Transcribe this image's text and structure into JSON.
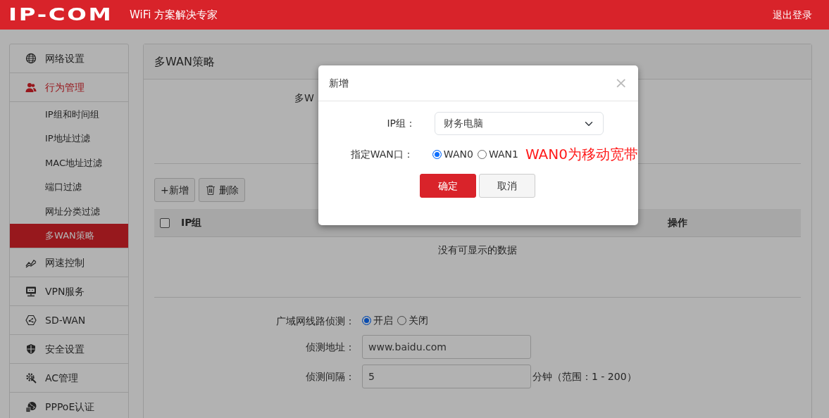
{
  "header": {
    "logo": "IP-COM",
    "tagline": "WiFi 方案解决专家",
    "logout": "退出登录"
  },
  "sidebar": {
    "items": [
      {
        "label": "网络设置",
        "expanded": false
      },
      {
        "label": "行为管理",
        "expanded": true,
        "children": [
          {
            "label": "IP组和时间组",
            "selected": false
          },
          {
            "label": "IP地址过滤",
            "selected": false
          },
          {
            "label": "MAC地址过滤",
            "selected": false
          },
          {
            "label": "端口过滤",
            "selected": false
          },
          {
            "label": "网址分类过滤",
            "selected": false
          },
          {
            "label": "多WAN策略",
            "selected": true
          }
        ]
      },
      {
        "label": "网速控制",
        "expanded": false
      },
      {
        "label": "VPN服务",
        "expanded": false
      },
      {
        "label": "SD-WAN",
        "expanded": false
      },
      {
        "label": "安全设置",
        "expanded": false
      },
      {
        "label": "AC管理",
        "expanded": false
      },
      {
        "label": "PPPoE认证",
        "expanded": false
      }
    ]
  },
  "panel": {
    "title": "多WAN策略",
    "hidden_label": "多W",
    "toolbar": [
      {
        "label": "+新增",
        "kind": "add"
      },
      {
        "label": "删除",
        "kind": "delete"
      }
    ],
    "table": {
      "select_all": false,
      "columns": [
        "IP组",
        "操作"
      ],
      "empty_text": "没有可显示的数据"
    },
    "detection": {
      "label": "广域网线路侦测：",
      "options": [
        {
          "label": "开启",
          "selected": true
        },
        {
          "label": "关闭",
          "selected": false
        }
      ]
    },
    "address": {
      "label": "侦测地址：",
      "value": "www.baidu.com"
    },
    "interval": {
      "label": "侦测间隔：",
      "value": "5",
      "unit": "分钟（范围：1 - 200）"
    }
  },
  "modal": {
    "title": "新增",
    "close": "×",
    "ip_group": {
      "label": "IP组：",
      "value": "财务电脑"
    },
    "wan": {
      "label": "指定WAN口：",
      "options": [
        {
          "label": "WAN0",
          "selected": true
        },
        {
          "label": "WAN1",
          "selected": false
        }
      ]
    },
    "annotation": "WAN0为移动宽带",
    "buttons": [
      {
        "label": "确定",
        "kind": "primary"
      },
      {
        "label": "取消",
        "kind": "secondary"
      }
    ]
  }
}
